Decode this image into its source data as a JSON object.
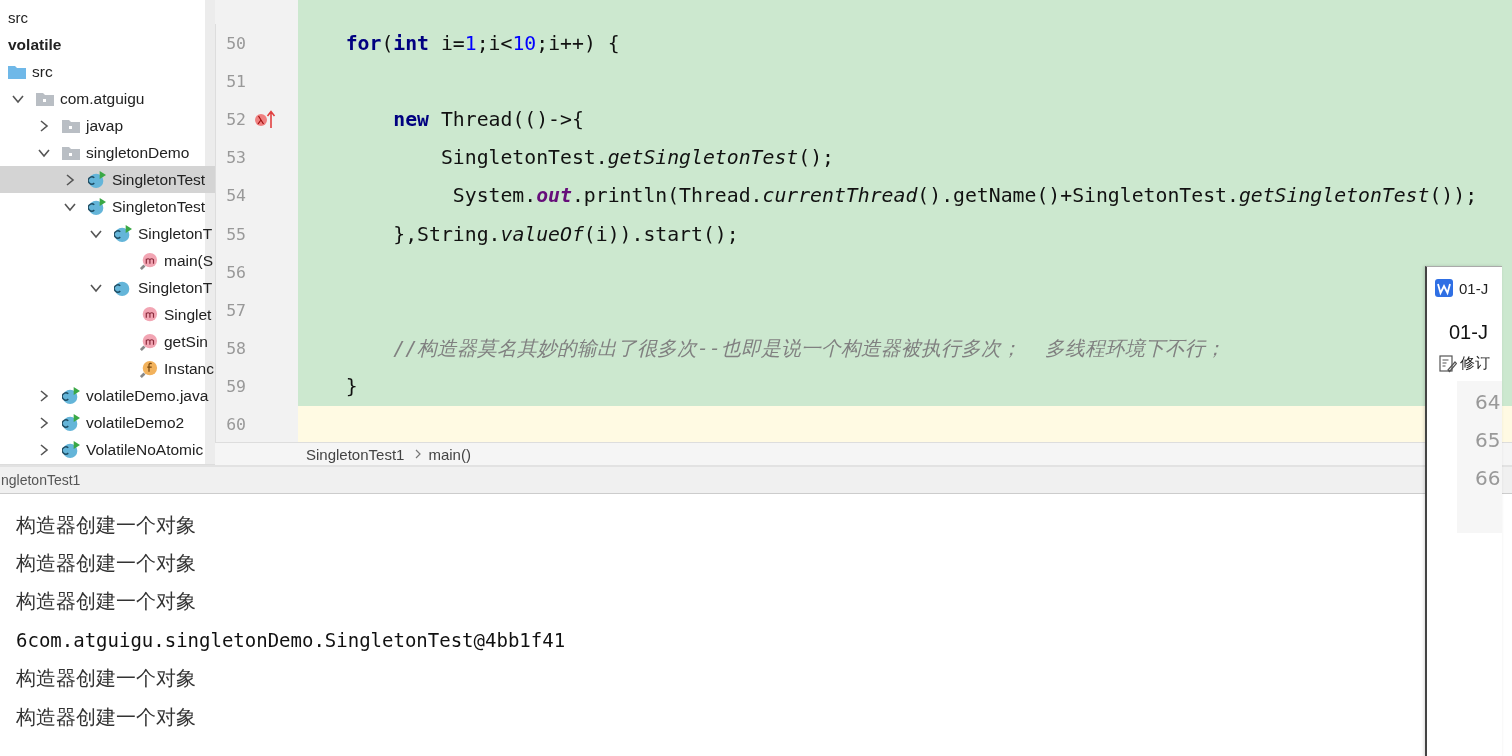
{
  "project_tree": {
    "items": [
      {
        "label": "src",
        "kind": "heading",
        "selected": false
      },
      {
        "label": "volatile",
        "kind": "module",
        "selected": false
      },
      {
        "label": "src",
        "kind": "source-folder",
        "selected": false
      },
      {
        "label": "com.atguigu",
        "kind": "package",
        "expanded": true,
        "selected": false,
        "children": [
          {
            "label": "javap",
            "kind": "package",
            "expanded": false,
            "selected": false
          },
          {
            "label": "singletonDemo",
            "kind": "package",
            "expanded": true,
            "selected": false,
            "children": [
              {
                "label": "SingletonTest",
                "kind": "class",
                "runnable": true,
                "expanded": false,
                "selected": true
              },
              {
                "label": "SingletonTest",
                "kind": "class",
                "runnable": true,
                "expanded": true,
                "selected": false,
                "children": [
                  {
                    "label": "SingletonT",
                    "kind": "class",
                    "runnable": true,
                    "expanded": true,
                    "selected": false,
                    "children": [
                      {
                        "label": "main(S",
                        "kind": "method",
                        "static": true,
                        "selected": false
                      }
                    ]
                  },
                  {
                    "label": "SingletonT",
                    "kind": "class",
                    "runnable": false,
                    "expanded": true,
                    "selected": false,
                    "children": [
                      {
                        "label": "Singlet",
                        "kind": "method",
                        "static": false,
                        "selected": false
                      },
                      {
                        "label": "getSin",
                        "kind": "method",
                        "static": true,
                        "selected": false
                      },
                      {
                        "label": "Instanc",
                        "kind": "field",
                        "static": true,
                        "selected": false
                      }
                    ]
                  }
                ]
              }
            ]
          },
          {
            "label": "volatileDemo.java",
            "kind": "class",
            "runnable": true,
            "expanded": false,
            "selected": false
          },
          {
            "label": "volatileDemo2",
            "kind": "class",
            "runnable": true,
            "expanded": false,
            "selected": false
          },
          {
            "label": "VolatileNoAtomic",
            "kind": "class",
            "runnable": true,
            "expanded": false,
            "selected": false
          }
        ]
      }
    ]
  },
  "editor": {
    "lines": [
      {
        "number": "50",
        "current": false,
        "tokens": [
          {
            "kind": "keyword",
            "text": "    for"
          },
          {
            "kind": "plain",
            "text": "("
          },
          {
            "kind": "keyword",
            "text": "int"
          },
          {
            "kind": "plain",
            "text": " i="
          },
          {
            "kind": "number",
            "text": "1"
          },
          {
            "kind": "plain",
            "text": ";i<"
          },
          {
            "kind": "number",
            "text": "10"
          },
          {
            "kind": "plain",
            "text": ";i++) {"
          }
        ]
      },
      {
        "number": "51",
        "current": false
      },
      {
        "number": "52",
        "current": false,
        "lambda_marker": true,
        "tokens": [
          {
            "kind": "keyword",
            "text": "        new"
          },
          {
            "kind": "plain",
            "text": " Thread(()->{"
          }
        ]
      },
      {
        "number": "53",
        "current": false,
        "tokens": [
          {
            "kind": "plain",
            "text": "            SingletonTest."
          },
          {
            "kind": "static-call",
            "text": "getSingletonTest"
          },
          {
            "kind": "plain",
            "text": "();"
          }
        ]
      },
      {
        "number": "54",
        "current": false,
        "tokens": [
          {
            "kind": "plain",
            "text": "             System."
          },
          {
            "kind": "static-field",
            "text": "out"
          },
          {
            "kind": "plain",
            "text": ".println(Thread."
          },
          {
            "kind": "static-call",
            "text": "currentThread"
          },
          {
            "kind": "plain",
            "text": "().getName()+SingletonTest."
          },
          {
            "kind": "static-call",
            "text": "getSingletonTest"
          },
          {
            "kind": "plain",
            "text": "());"
          }
        ]
      },
      {
        "number": "55",
        "current": false,
        "tokens": [
          {
            "kind": "plain",
            "text": "        },String."
          },
          {
            "kind": "static-call",
            "text": "valueOf"
          },
          {
            "kind": "plain",
            "text": "(i)).start();"
          }
        ]
      },
      {
        "number": "56",
        "current": false
      },
      {
        "number": "57",
        "current": false
      },
      {
        "number": "58",
        "current": false,
        "tokens": [
          {
            "kind": "comment",
            "text": "        //构造器莫名其妙的输出了很多次--也即是说一个构造器被执行多次；  多线程环境下不行；"
          }
        ]
      },
      {
        "number": "59",
        "current": false,
        "tokens": [
          {
            "kind": "plain",
            "text": "    }"
          }
        ]
      },
      {
        "number": "60",
        "current": true
      }
    ],
    "breadcrumbs": [
      "SingletonTest1",
      "main()"
    ]
  },
  "run_panel": {
    "tab": "ngletonTest1",
    "output": [
      {
        "kind": "message",
        "text": "构造器创建一个对象"
      },
      {
        "kind": "message",
        "text": "构造器创建一个对象"
      },
      {
        "kind": "message",
        "text": "构造器创建一个对象"
      },
      {
        "kind": "object",
        "text": "6com.atguigu.singletonDemo.SingletonTest@4bb1f41"
      },
      {
        "kind": "message",
        "text": "构造器创建一个对象"
      },
      {
        "kind": "message",
        "text": "构造器创建一个对象"
      }
    ]
  },
  "document_window": {
    "title": "01-J",
    "heading": "01-J",
    "toolbar_item": "修订",
    "line_numbers": [
      "64",
      "65",
      "66"
    ]
  }
}
